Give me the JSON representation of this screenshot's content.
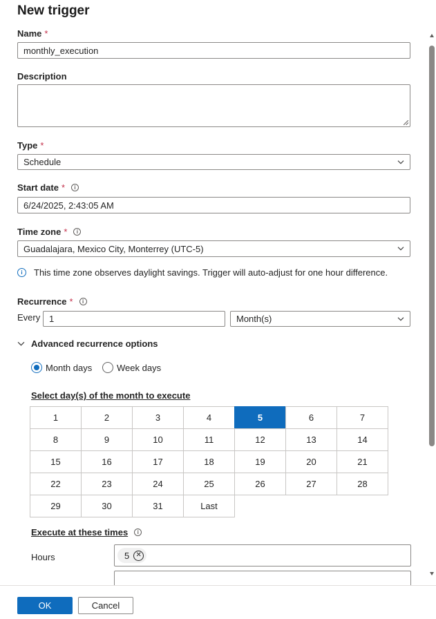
{
  "title": "New trigger",
  "name": {
    "label": "Name",
    "value": "monthly_execution"
  },
  "description": {
    "label": "Description",
    "value": ""
  },
  "type": {
    "label": "Type",
    "value": "Schedule"
  },
  "start_date": {
    "label": "Start date",
    "value": "6/24/2025, 2:43:05 AM"
  },
  "time_zone": {
    "label": "Time zone",
    "value": "Guadalajara, Mexico City, Monterrey (UTC-5)",
    "note": "This time zone observes daylight savings. Trigger will auto-adjust for one hour difference."
  },
  "recurrence": {
    "label": "Recurrence",
    "every_label": "Every",
    "interval": "1",
    "unit": "Month(s)"
  },
  "advanced": {
    "toggle_label": "Advanced recurrence options",
    "month_days_label": "Month days",
    "week_days_label": "Week days",
    "selected_mode": "month_days",
    "select_days_label": "Select day(s) of the month to execute",
    "days": [
      [
        "1",
        "2",
        "3",
        "4",
        "5",
        "6",
        "7"
      ],
      [
        "8",
        "9",
        "10",
        "11",
        "12",
        "13",
        "14"
      ],
      [
        "15",
        "16",
        "17",
        "18",
        "19",
        "20",
        "21"
      ],
      [
        "22",
        "23",
        "24",
        "25",
        "26",
        "27",
        "28"
      ],
      [
        "29",
        "30",
        "31",
        "Last"
      ]
    ],
    "selected_days": [
      "5"
    ],
    "execute_times_label": "Execute at these times",
    "hours_label": "Hours",
    "hours_chips": [
      "5"
    ]
  },
  "footer": {
    "ok_label": "OK",
    "cancel_label": "Cancel"
  },
  "colors": {
    "accent": "#0f6cbd",
    "required": "#c4314b",
    "border": "#8a8886"
  }
}
